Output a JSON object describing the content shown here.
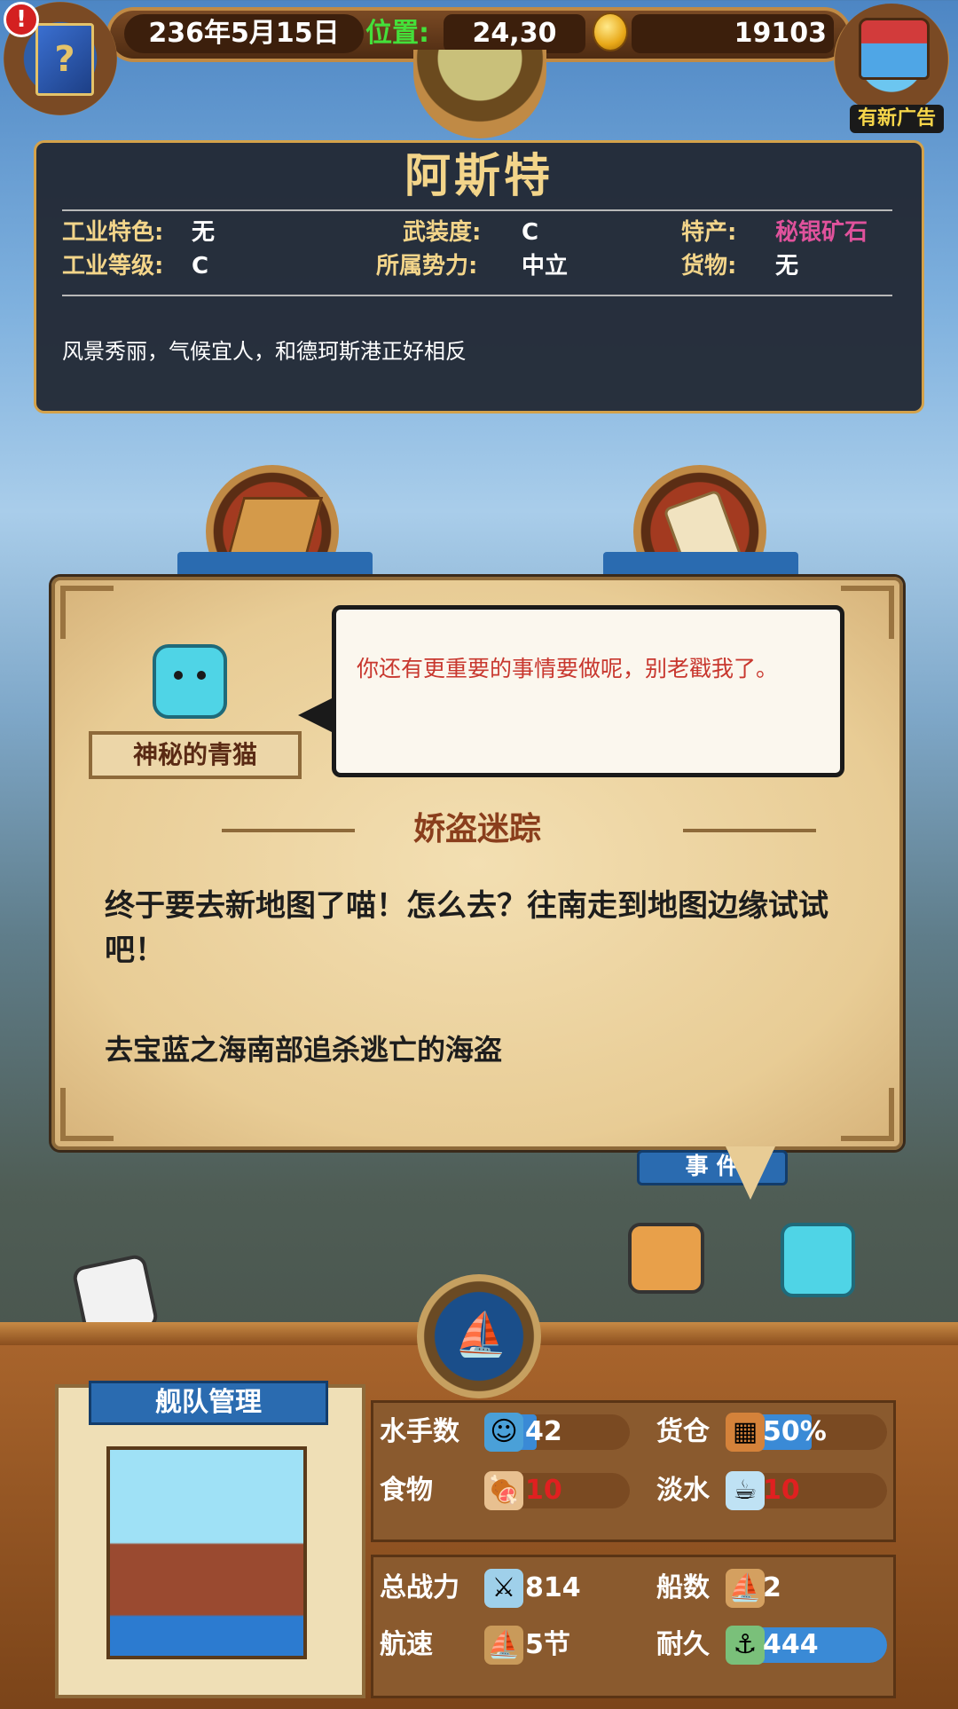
{
  "top_bar": {
    "date": "236年5月15日",
    "position_label": "位置:",
    "position_value": "24,30",
    "gold": "19103",
    "ad_label": "有新广告",
    "book_glyph": "?"
  },
  "city": {
    "name": "阿斯特",
    "fields": [
      {
        "label": "工业特色:",
        "value": "无"
      },
      {
        "label": "武装度:",
        "value": "C"
      },
      {
        "label": "特产:",
        "value": "秘银矿石"
      },
      {
        "label": "工业等级:",
        "value": "C"
      },
      {
        "label": "所属势力:",
        "value": "中立"
      },
      {
        "label": "货物:",
        "value": "无"
      }
    ],
    "description": "风景秀丽，气候宜人，和德珂斯港正好相反",
    "special_color": "#e0529c"
  },
  "dialog": {
    "npc_name": "神秘的青猫",
    "speech": "你还有更重要的事情要做呢，别老戳我了。",
    "quest_title": "娇盗迷踪",
    "quest_body": "终于要去新地图了喵！怎么去？往南走到地图边缘试试吧！",
    "quest_goal": "去宝蓝之海南部追杀逃亡的海盗",
    "event_button_partial": "事 件"
  },
  "fleet": {
    "title": "舰队管理",
    "stats": [
      {
        "label": "水手数",
        "value": "42",
        "fill": 0.3,
        "value_color": "#ffffff",
        "icon": "sailor-icon"
      },
      {
        "label": "货仓",
        "value": "50%",
        "fill": 0.5,
        "value_color": "#ffffff",
        "icon": "cargo-icon"
      },
      {
        "label": "食物",
        "value": "10",
        "fill": 0.08,
        "value_color": "#e02020",
        "icon": "meat-icon"
      },
      {
        "label": "淡水",
        "value": "10",
        "fill": 0.08,
        "value_color": "#e02020",
        "icon": "water-icon"
      }
    ],
    "stats2": [
      {
        "label": "总战力",
        "value": "814",
        "icon": "swords-icon"
      },
      {
        "label": "船数",
        "value": "2",
        "icon": "ship-icon"
      },
      {
        "label": "航速",
        "value": "5节",
        "icon": "sail-icon"
      },
      {
        "label": "耐久",
        "value": "444",
        "fill": 1.0,
        "icon": "repair-icon"
      }
    ]
  },
  "colors": {
    "accent_gold": "#f3d58a",
    "panel_dark": "#222834",
    "bar_blue": "#3a8ad6",
    "alert_red": "#c8372e"
  }
}
